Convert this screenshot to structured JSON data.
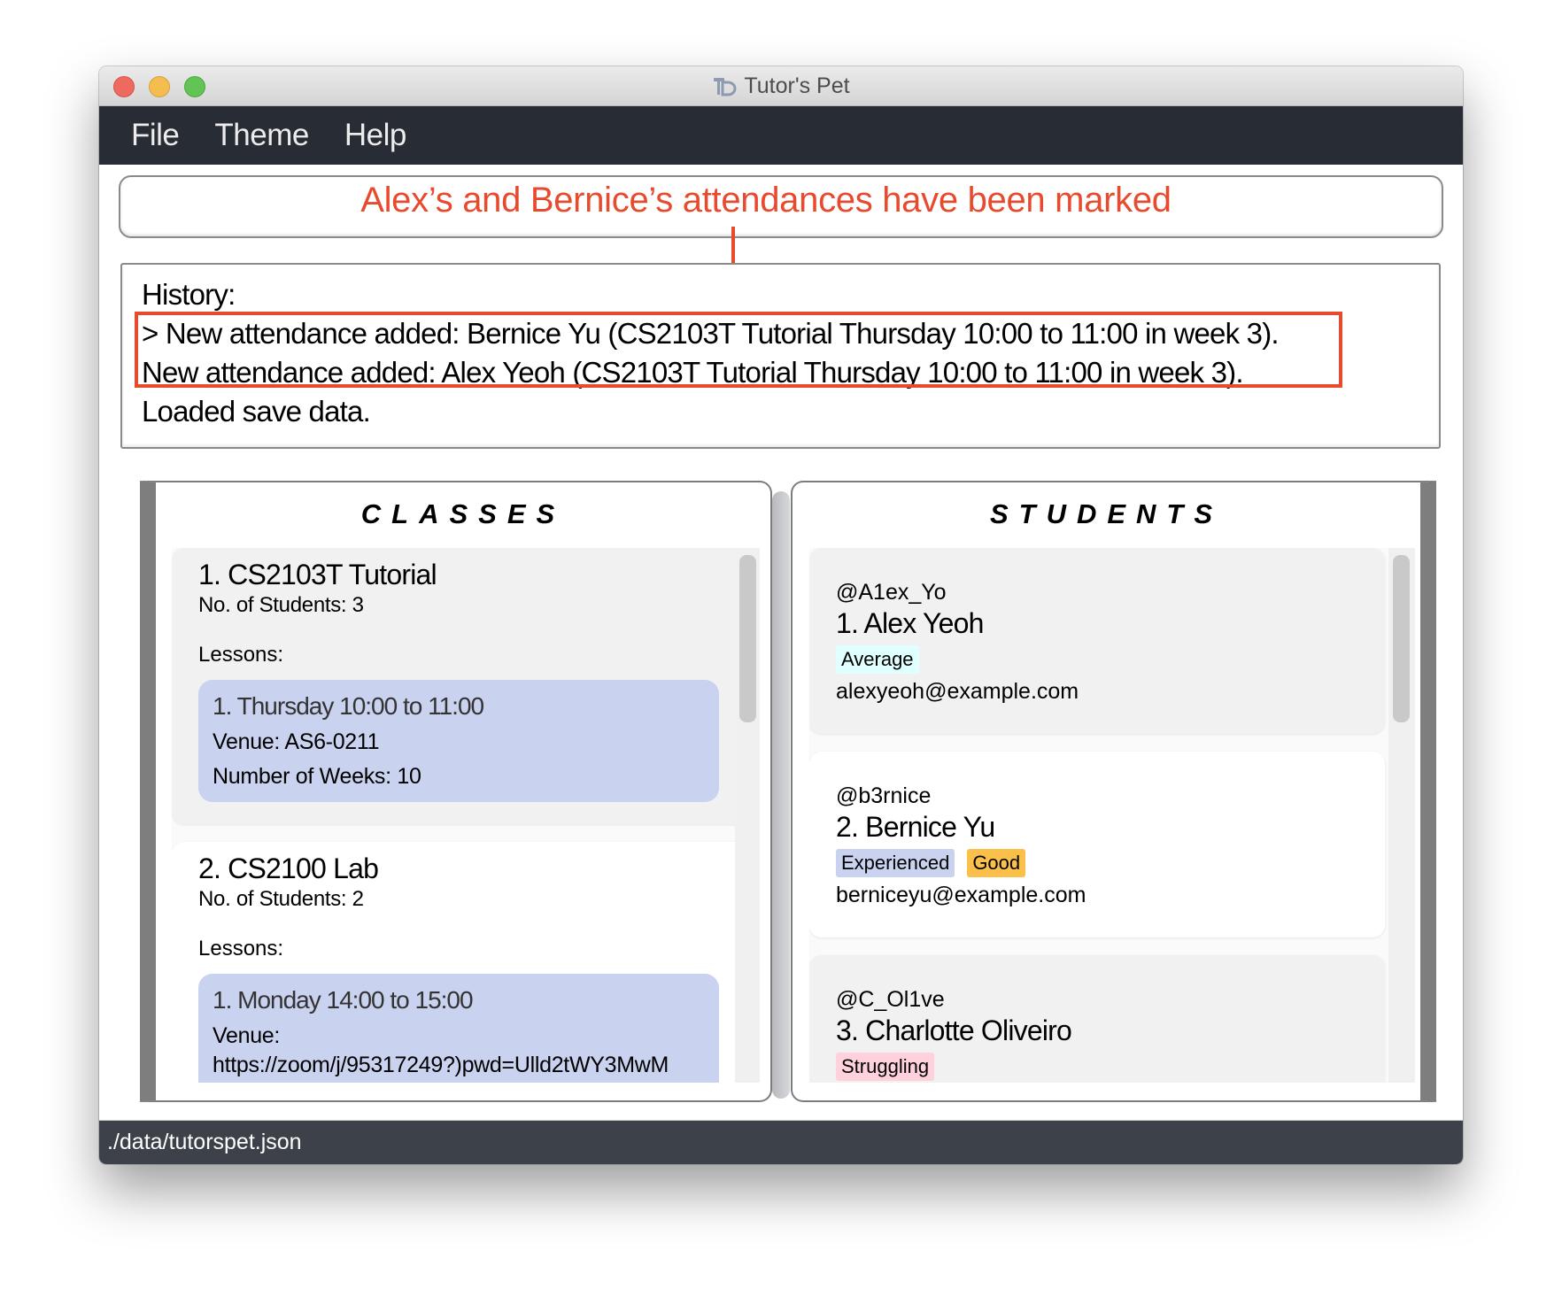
{
  "window": {
    "title": "Tutor's Pet",
    "app_icon": "tutors-pet-logo-icon"
  },
  "menu": {
    "items": [
      {
        "label": "File"
      },
      {
        "label": "Theme"
      },
      {
        "label": "Help"
      }
    ]
  },
  "annotation": {
    "text": "Alex’s and Bernice’s attendances have been marked",
    "color": "#e84a2d"
  },
  "history": {
    "lines": [
      "History:",
      "> New attendance added: Bernice Yu (CS2103T Tutorial Thursday 10:00 to 11:00 in week 3).",
      "New attendance added: Alex Yeoh (CS2103T Tutorial Thursday 10:00 to 11:00 in week 3).",
      "Loaded save data."
    ]
  },
  "classes_panel": {
    "title": "CLASSES",
    "items": [
      {
        "title": "1.  CS2103T Tutorial",
        "students": "No. of Students:  3",
        "lessons_label": "Lessons:",
        "lessons": [
          {
            "title": "1. Thursday 10:00 to 11:00",
            "venue": "Venue: AS6-0211",
            "weeks": "Number of Weeks: 10"
          }
        ]
      },
      {
        "title": "2.  CS2100 Lab",
        "students": "No. of Students:  2",
        "lessons_label": "Lessons:",
        "lessons": [
          {
            "title": "1. Monday 14:00 to 15:00",
            "venue": "Venue:",
            "venue_url": "https://zoom/j/95317249?)pwd=Ulld2tWY3MwM"
          }
        ]
      }
    ]
  },
  "students_panel": {
    "title": "STUDENTS",
    "items": [
      {
        "handle": "@A1ex_Yo",
        "name": "1.  Alex Yeoh",
        "tags": [
          {
            "label": "Average",
            "color": "#e0ffff"
          }
        ],
        "email": "alexyeoh@example.com"
      },
      {
        "handle": "@b3rnice",
        "name": "2.  Bernice Yu",
        "tags": [
          {
            "label": "Experienced",
            "color": "#c9d2ee"
          },
          {
            "label": "Good",
            "color": "#fbc04a"
          }
        ],
        "email": "berniceyu@example.com"
      },
      {
        "handle": "@C_Ol1ve",
        "name": "3.  Charlotte Oliveiro",
        "tags": [
          {
            "label": "Struggling",
            "color": "#ffd1dc"
          }
        ],
        "email": ""
      }
    ]
  },
  "status_bar": {
    "path": "./data/tutorspet.json"
  }
}
